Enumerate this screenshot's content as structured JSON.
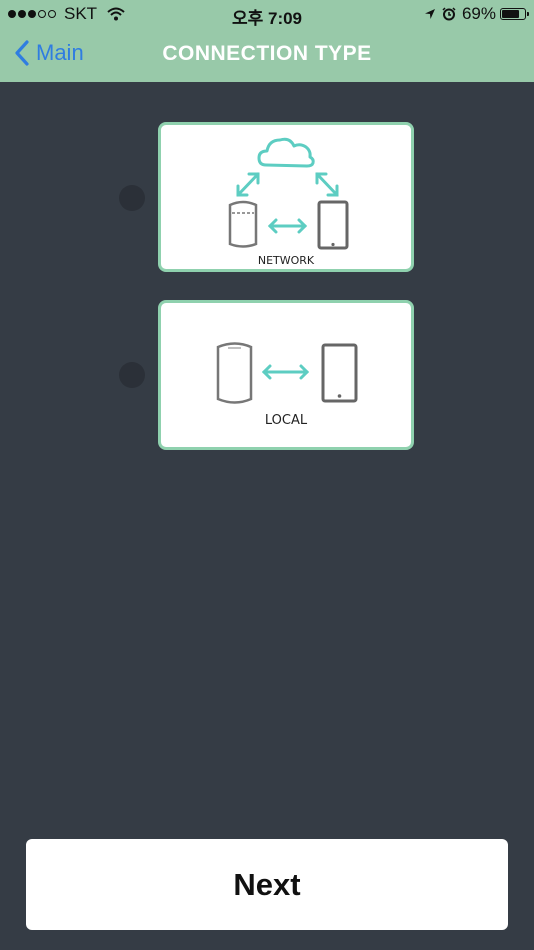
{
  "status_bar": {
    "carrier": "SKT",
    "signal_bars_filled": 3,
    "signal_bars_total": 5,
    "time": "오후 7:09",
    "battery_percent": "69%",
    "icons": [
      "wifi-icon",
      "location-arrow-icon",
      "alarm-icon",
      "battery-icon"
    ]
  },
  "nav": {
    "back_label": "Main",
    "title": "CONNECTION TYPE"
  },
  "options": [
    {
      "label": "NETWORK",
      "icons": [
        "cloud-icon",
        "speaker-icon",
        "phone-icon"
      ],
      "selected": false
    },
    {
      "label": "LOCAL",
      "icons": [
        "speaker-icon",
        "phone-icon"
      ],
      "selected": false
    }
  ],
  "next_button": {
    "label": "Next"
  },
  "colors": {
    "header": "#98c9a9",
    "background": "#353c45",
    "card_border": "#8fd1ae",
    "accent_teal": "#5dcdc2",
    "back_link": "#2f7de1"
  }
}
